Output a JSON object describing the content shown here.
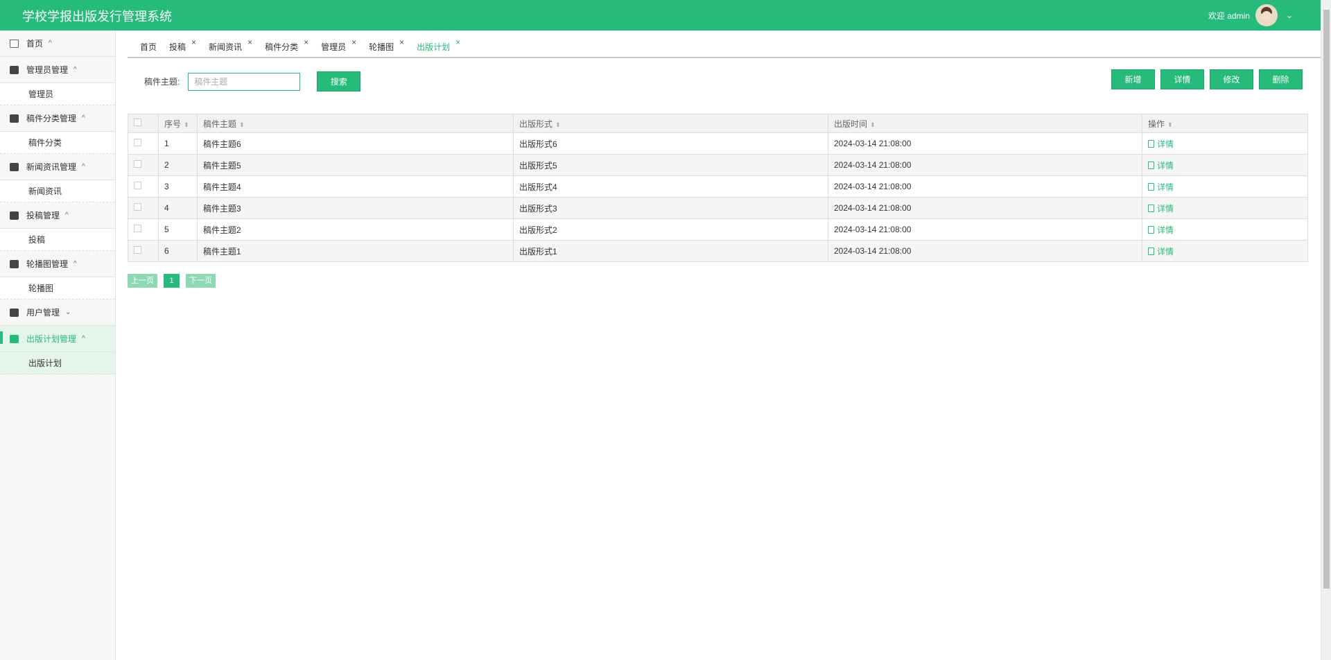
{
  "header": {
    "title": "学校学报出版发行管理系统",
    "welcome": "欢迎 admin",
    "dropdown": "⌄"
  },
  "sidebar": [
    {
      "label": "首页",
      "caret": "^",
      "icon": "home-icon",
      "items": []
    },
    {
      "label": "管理员管理",
      "caret": "^",
      "icon": "server-icon",
      "items": [
        "管理员"
      ]
    },
    {
      "label": "稿件分类管理",
      "caret": "^",
      "icon": "grid-icon",
      "items": [
        "稿件分类"
      ]
    },
    {
      "label": "新闻资讯管理",
      "caret": "^",
      "icon": "image-icon",
      "items": [
        "新闻资讯"
      ]
    },
    {
      "label": "投稿管理",
      "caret": "^",
      "icon": "dashboard-icon",
      "items": [
        "投稿"
      ]
    },
    {
      "label": "轮播图管理",
      "caret": "^",
      "icon": "disc-icon",
      "items": [
        "轮播图"
      ]
    },
    {
      "label": "用户管理",
      "caret": "⌄",
      "icon": "user-icon",
      "items": []
    },
    {
      "label": "出版计划管理",
      "caret": "^",
      "icon": "wallet-icon",
      "items": [
        "出版计划"
      ],
      "active": true
    }
  ],
  "tabs": [
    {
      "label": "首页"
    },
    {
      "label": "投稿",
      "close": "×"
    },
    {
      "label": "新闻资讯",
      "close": "×"
    },
    {
      "label": "稿件分类",
      "close": "×"
    },
    {
      "label": "管理员",
      "close": "×"
    },
    {
      "label": "轮播图",
      "close": "×"
    },
    {
      "label": "出版计划",
      "close": "×",
      "active": true
    }
  ],
  "search": {
    "label": "稿件主题:",
    "placeholder": "稿件主题",
    "value": "",
    "button": "搜索"
  },
  "toolbar": {
    "add": "新增",
    "detail": "详情",
    "edit": "修改",
    "delete": "删除"
  },
  "table": {
    "columns": [
      "序号",
      "稿件主题",
      "出版形式",
      "出版时间",
      "操作"
    ],
    "rows": [
      {
        "no": "1",
        "title": "稿件主题6",
        "form": "出版形式6",
        "time": "2024-03-14 21:08:00",
        "op": "详情"
      },
      {
        "no": "2",
        "title": "稿件主题5",
        "form": "出版形式5",
        "time": "2024-03-14 21:08:00",
        "op": "详情"
      },
      {
        "no": "3",
        "title": "稿件主题4",
        "form": "出版形式4",
        "time": "2024-03-14 21:08:00",
        "op": "详情"
      },
      {
        "no": "4",
        "title": "稿件主题3",
        "form": "出版形式3",
        "time": "2024-03-14 21:08:00",
        "op": "详情"
      },
      {
        "no": "5",
        "title": "稿件主题2",
        "form": "出版形式2",
        "time": "2024-03-14 21:08:00",
        "op": "详情"
      },
      {
        "no": "6",
        "title": "稿件主题1",
        "form": "出版形式1",
        "time": "2024-03-14 21:08:00",
        "op": "详情"
      }
    ]
  },
  "pager": {
    "prev": "上一页",
    "current": "1",
    "next": "下一页"
  },
  "colors": {
    "accent": "#26bb7a"
  }
}
